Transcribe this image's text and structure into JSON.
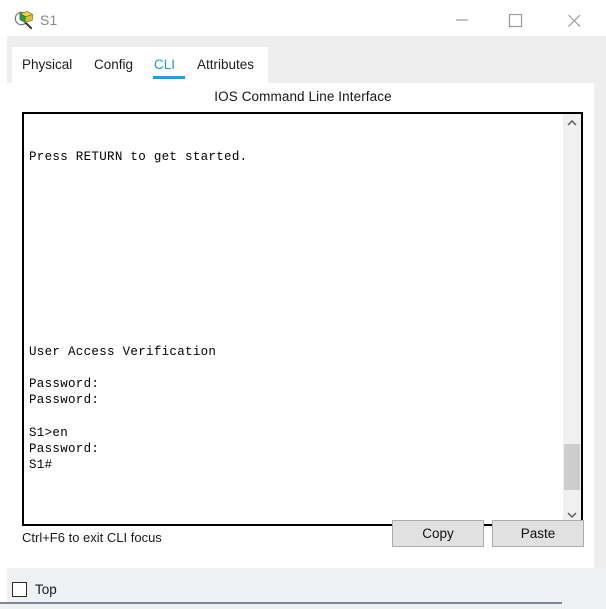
{
  "window": {
    "title": "S1",
    "icon": "packet-tracer-inspect-icon",
    "controls": {
      "minimize": "minimize-icon",
      "maximize": "maximize-icon",
      "close": "close-icon"
    }
  },
  "tabs": [
    {
      "label": "Physical",
      "active": false
    },
    {
      "label": "Config",
      "active": false
    },
    {
      "label": "CLI",
      "active": true
    },
    {
      "label": "Attributes",
      "active": false
    }
  ],
  "content": {
    "heading": "IOS Command Line Interface",
    "terminal_text": "\n\nPress RETURN to get started.\n\n\n\n\n\n\n\n\n\n\n\nUser Access Verification\n\nPassword:\nPassword:\n\nS1>en\nPassword:\nS1#",
    "scrollbar": {
      "up_arrow": "chevron-up-icon",
      "down_arrow": "chevron-down-icon",
      "thumb_position": "bottom"
    }
  },
  "footer": {
    "hint": "Ctrl+F6 to exit CLI focus",
    "copy_label": "Copy",
    "paste_label": "Paste"
  },
  "bottom_bar": {
    "top_checkbox_label": "Top",
    "top_checkbox_checked": false
  },
  "background": {
    "top_sliver": "▪▪▪ ▪▪▪▪▪▪▪▪▪ ▪▪▪▪▪ ▪▪▪▪▪▪▪ ▪▪▪▪▪▪ ▪▪▪",
    "bottom_sliver": "▪▪▪▪▪▪ ▪▪▪▪▪▪▪ ▪▪▪▪▪▪▪▪▪▪"
  },
  "colors": {
    "accent": "#19a0e0",
    "panel": "#ffffff",
    "chrome": "#eeeeee",
    "button_face": "#e1e1e1",
    "terminal_border": "#000000",
    "scroll_thumb": "#cdcdcd"
  }
}
